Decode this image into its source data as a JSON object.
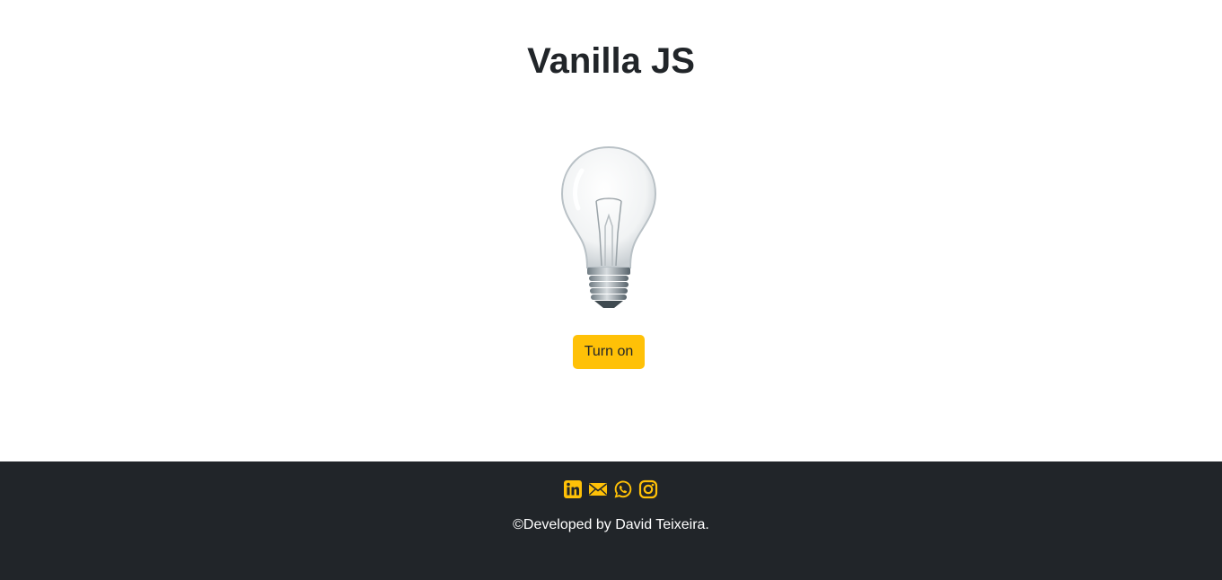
{
  "header": {
    "title": "Vanilla JS"
  },
  "lamp": {
    "state": "off",
    "image_icon": "light-bulb-icon"
  },
  "controls": {
    "toggle_label": "Turn on"
  },
  "footer": {
    "social_icons": [
      "linkedin-icon",
      "envelope-icon",
      "whatsapp-icon",
      "instagram-icon"
    ],
    "copyright": "©Developed by David Teixeira."
  },
  "colors": {
    "accent": "#ffc107",
    "footer_bg": "#212529",
    "text_dark": "#212529",
    "text_light": "#ffffff"
  }
}
